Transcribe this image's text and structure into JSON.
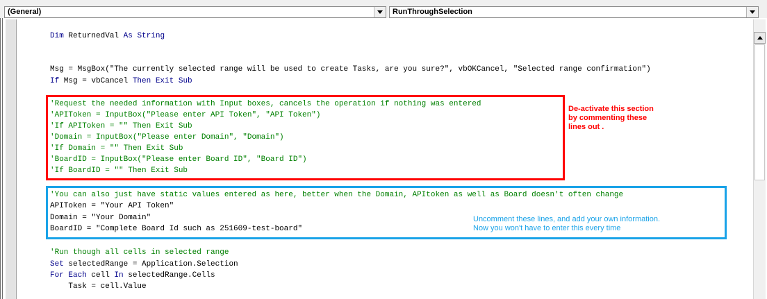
{
  "toolbar": {
    "object_dropdown": "(General)",
    "procedure_dropdown": "RunThroughSelection"
  },
  "colors": {
    "keyword": "#00008b",
    "comment": "#008000",
    "plain": "#000000",
    "red_box": "#ff0000",
    "blue_box": "#1aa3e8"
  },
  "code": {
    "l1": {
      "kw1": "Dim",
      "t1": " ReturnedVal ",
      "kw2": "As String"
    },
    "l2": "Msg = MsgBox(\"The currently selected range will be used to create Tasks, are you sure?\", vbOKCancel, \"Selected range confirmation\")",
    "l3": {
      "kw1": "If",
      "t1": " Msg = vbCancel ",
      "kw2": "Then Exit Sub"
    },
    "red_section": [
      "'Request the needed information with Input boxes, cancels the operation if nothing was entered",
      "'APIToken = InputBox(\"Please enter API Token\", \"API Token\")",
      "'If APIToken = \"\" Then Exit Sub",
      "'Domain = InputBox(\"Please enter Domain\", \"Domain\")",
      "'If Domain = \"\" Then Exit Sub",
      "'BoardID = InputBox(\"Please enter Board ID\", \"Board ID\")",
      "'If BoardID = \"\" Then Exit Sub"
    ],
    "blue_comment": "'You can also just have static values entered as here, better when the Domain, APItoken as well as Board doesn't often change",
    "blue_lines": [
      "APIToken = \"Your API Token\"",
      "Domain = \"Your Domain\"",
      "BoardID = \"Complete Board Id such as 251609-test-board\""
    ],
    "loop_comment": "'Run though all cells in selected range",
    "l_set": {
      "kw1": "Set",
      "t1": " selectedRange = Application.Selection"
    },
    "l_for": {
      "kw1": "For Each",
      "t1": " cell ",
      "kw2": "In",
      "t2": " selectedRange.Cells"
    },
    "l_task": "    Task = cell.Value"
  },
  "notes": {
    "red": [
      "De-activate this section",
      "by commenting these",
      "lines out ."
    ],
    "blue": [
      "Uncomment these lines, and add your own information.",
      "Now you won't have to enter this every time"
    ]
  }
}
